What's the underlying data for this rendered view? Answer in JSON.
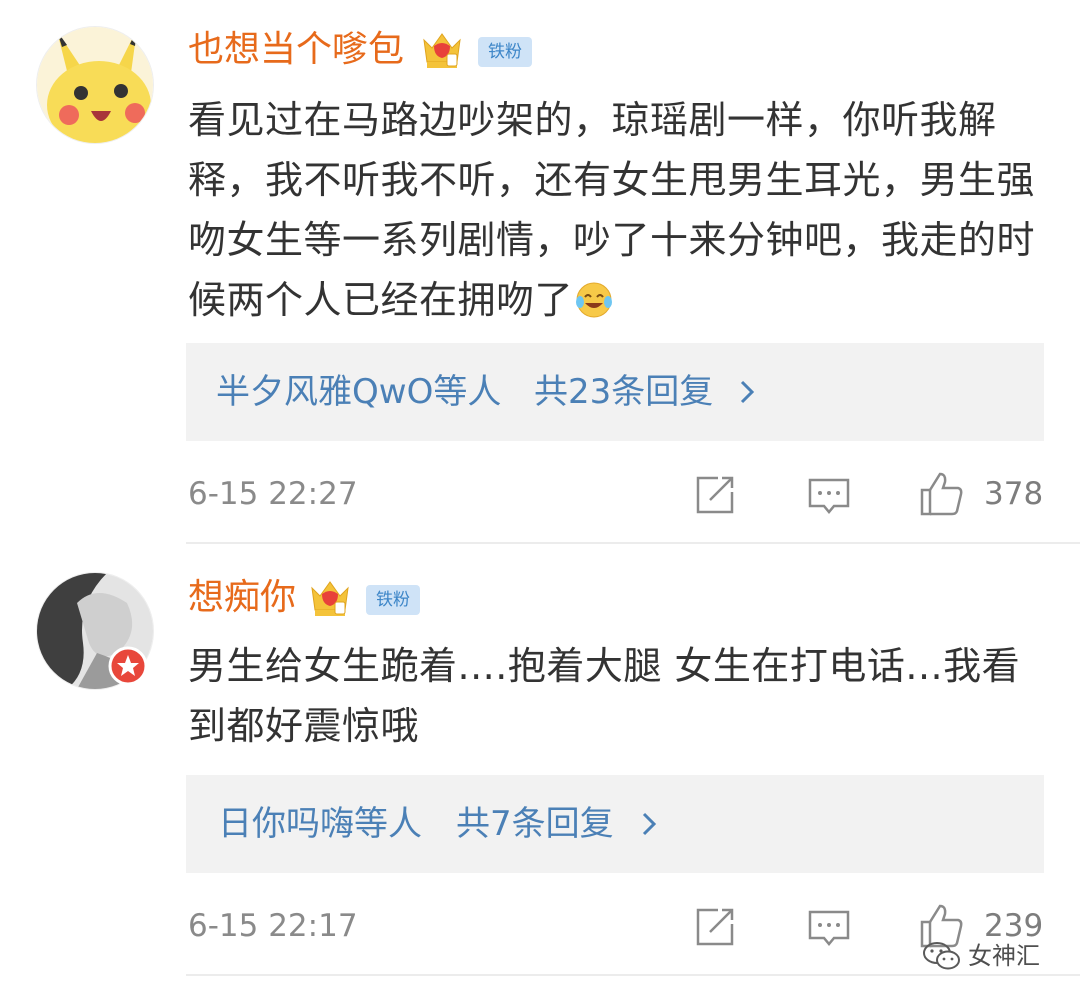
{
  "comments": [
    {
      "username": "也想当个嗲包",
      "badge": "铁粉",
      "text": "看见过在马路边吵架的，琼瑶剧一样，你听我解释，我不听我不听，还有女生甩男生耳光，男生强吻女生等一系列剧情，吵了十来分钟吧，我走的时候两个人已经在拥吻了",
      "emoji": "laugh-cry-icon",
      "reply_users": "半夕风雅QwO等人",
      "reply_total": "共23条回复",
      "time": "6-15 22:27",
      "likes": "378"
    },
    {
      "username": "想痴你",
      "badge": "铁粉",
      "text": "男生给女生跪着....抱着大腿 女生在打电话...我看到都好震惊哦",
      "reply_users": "日你吗嗨等人",
      "reply_total": "共7条回复",
      "time": "6-15 22:17",
      "likes": "239"
    }
  ],
  "watermark": "女神汇",
  "colors": {
    "username": "#e76a1b",
    "link": "#4b80b6",
    "badge_bg": "#cfe3f7",
    "badge_text": "#3d86c8",
    "reply_bg": "#f2f2f2"
  }
}
